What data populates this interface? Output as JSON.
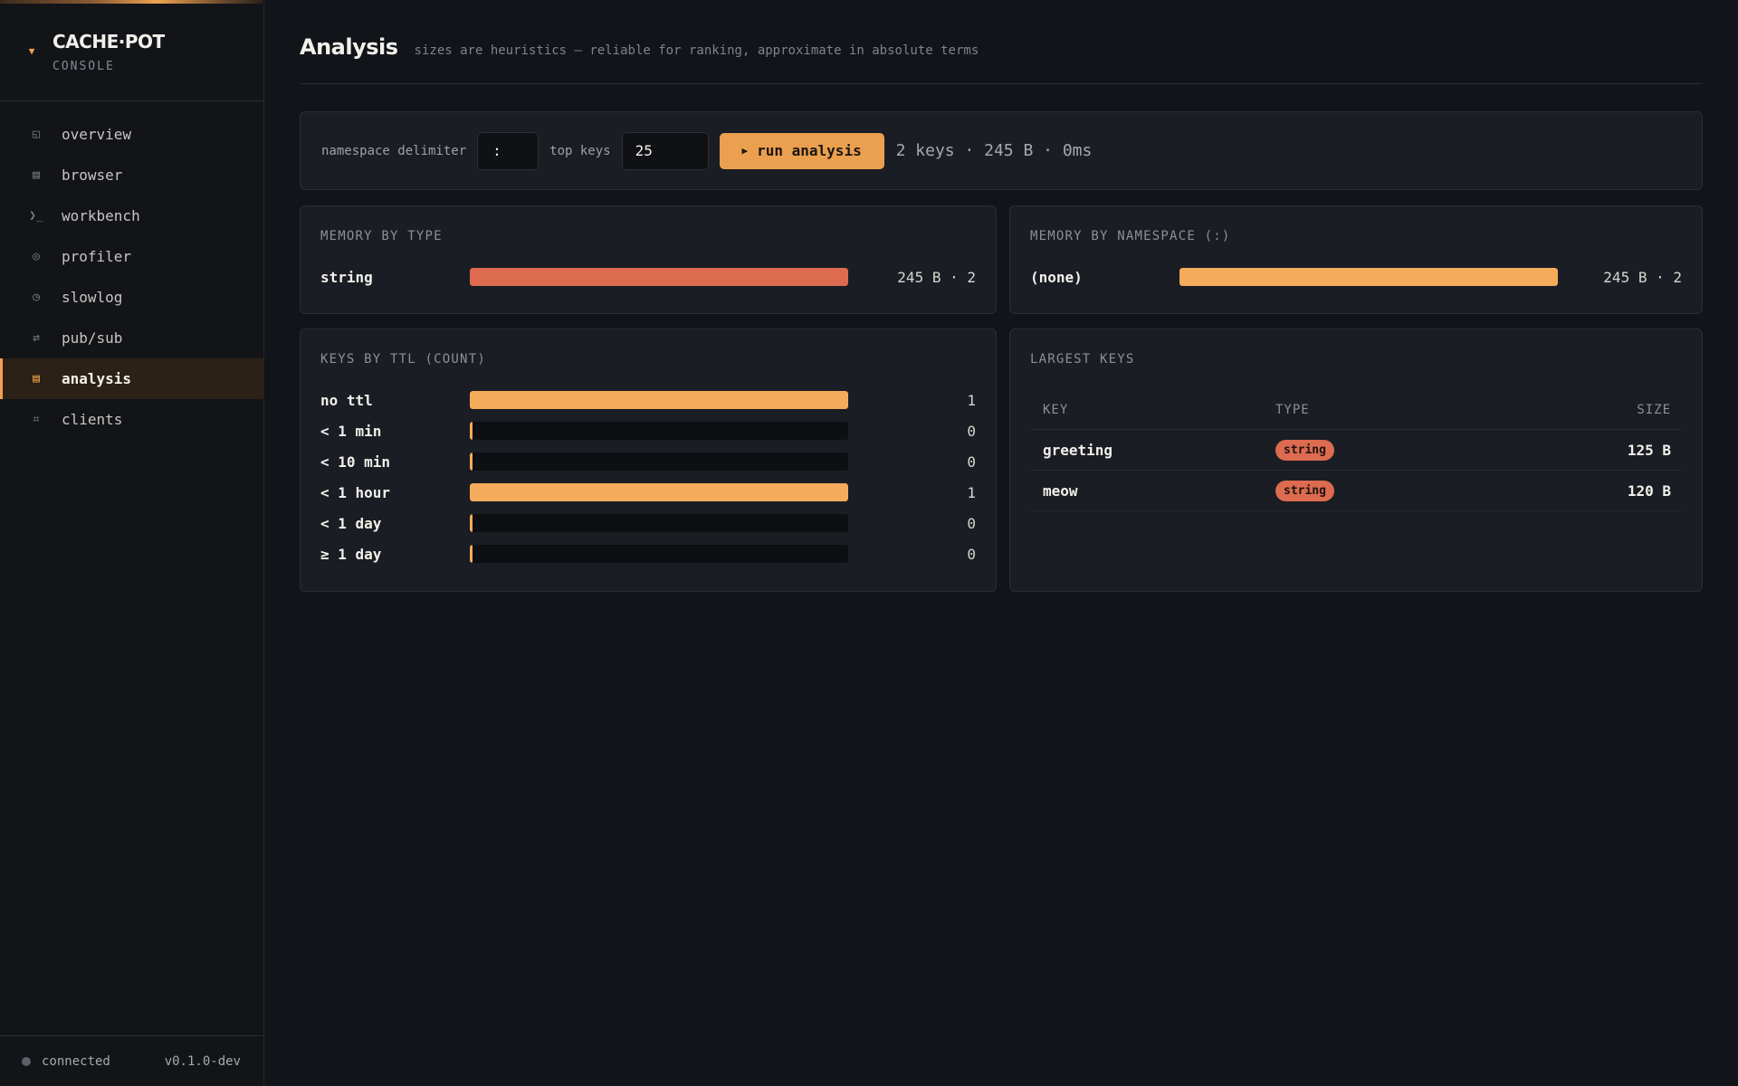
{
  "sidebar": {
    "brand_name": "CACHE·POT",
    "brand_sub": "CONSOLE",
    "items": [
      {
        "label": "overview",
        "icon": "◱"
      },
      {
        "label": "browser",
        "icon": "▤"
      },
      {
        "label": "workbench",
        "icon": "❯_"
      },
      {
        "label": "profiler",
        "icon": "◎"
      },
      {
        "label": "slowlog",
        "icon": "◷"
      },
      {
        "label": "pub/sub",
        "icon": "⇄"
      },
      {
        "label": "analysis",
        "icon": "▤"
      },
      {
        "label": "clients",
        "icon": "⌗"
      }
    ],
    "active": "analysis",
    "status": "connected",
    "version": "v0.1.0-dev"
  },
  "header": {
    "title": "Analysis",
    "subtitle": "sizes are heuristics — reliable for ranking, approximate in absolute terms"
  },
  "toolbar": {
    "delimiter_label": "namespace delimiter",
    "delimiter_value": ":",
    "topkeys_label": "top keys",
    "topkeys_value": "25",
    "run_label": "run analysis",
    "summary": "2 keys · 245 B · 0ms"
  },
  "memory_by_type": {
    "title": "MEMORY BY TYPE",
    "rows": [
      {
        "label": "string",
        "fraction": 1.0,
        "value": "245 B · 2",
        "color": "#dc6b50"
      }
    ]
  },
  "memory_by_namespace": {
    "title": "MEMORY BY NAMESPACE (:)",
    "rows": [
      {
        "label": "(none)",
        "fraction": 1.0,
        "value": "245 B · 2",
        "color": "#f5ab5c"
      }
    ]
  },
  "keys_by_ttl": {
    "title": "KEYS BY TTL (COUNT)",
    "rows": [
      {
        "label": "no ttl",
        "fraction": 1.0,
        "value": "1"
      },
      {
        "label": "< 1 min",
        "fraction": 0.0,
        "value": "0"
      },
      {
        "label": "< 10 min",
        "fraction": 0.0,
        "value": "0"
      },
      {
        "label": "< 1 hour",
        "fraction": 1.0,
        "value": "1"
      },
      {
        "label": "< 1 day",
        "fraction": 0.0,
        "value": "0"
      },
      {
        "label": "≥ 1 day",
        "fraction": 0.0,
        "value": "0"
      }
    ],
    "color": "#f5ab5c"
  },
  "largest_keys": {
    "title": "LARGEST KEYS",
    "columns": {
      "key": "KEY",
      "type": "TYPE",
      "size": "SIZE"
    },
    "rows": [
      {
        "key": "greeting",
        "type": "string",
        "size": "125 B"
      },
      {
        "key": "meow",
        "type": "string",
        "size": "120 B"
      }
    ]
  },
  "colors": {
    "accent": "#f0a24e",
    "string_type": "#dc6b50",
    "bar": "#f5ab5c"
  }
}
